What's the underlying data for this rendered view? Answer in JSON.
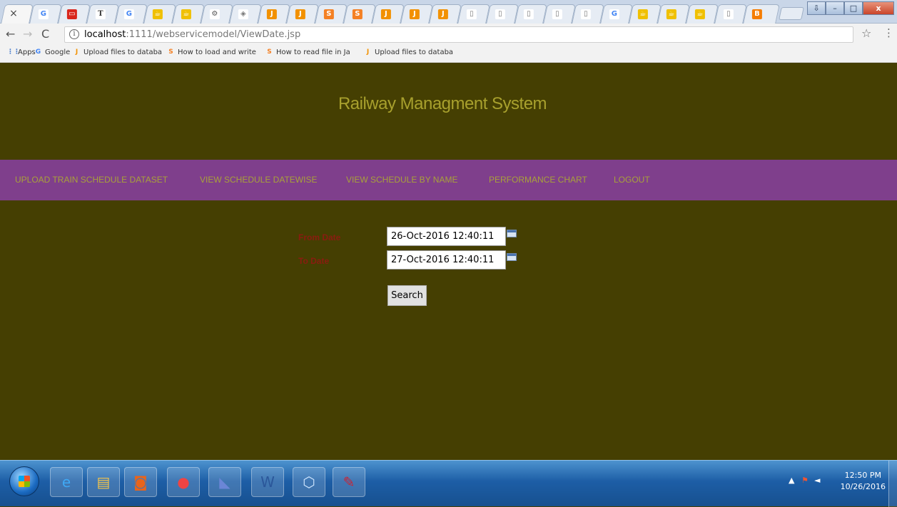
{
  "browser": {
    "url_host": "localhost",
    "url_rest": ":1111/webservicemodel/ViewDate.jsp",
    "bookmarks": [
      {
        "label": "Apps",
        "icon": "apps-grid-icon"
      },
      {
        "label": "Google",
        "icon": "google-icon"
      },
      {
        "label": "Upload files to databa",
        "icon": "javatpoint-icon"
      },
      {
        "label": "How to load and write",
        "icon": "stackoverflow-icon"
      },
      {
        "label": "How to read file in Ja",
        "icon": "stackoverflow-icon"
      },
      {
        "label": "Upload files to databa",
        "icon": "javatpoint-icon"
      }
    ]
  },
  "site": {
    "title": "Railway Managment System"
  },
  "nav": {
    "upload": "UPLOAD TRAIN SCHEDULE DATASET",
    "datewise": "VIEW SCHEDULE DATEWISE",
    "byname": "VIEW SCHEDULE BY NAME",
    "chart": "PERFORMANCE CHART",
    "logout": "LOGOUT"
  },
  "form": {
    "from_label": "From Date",
    "from_value": "26-Oct-2016 12:40:11",
    "to_label": "To Date",
    "to_value": "27-Oct-2016 12:40:11",
    "search_label": "Search"
  },
  "taskbar": {
    "time": "12:50 PM",
    "date": "10/26/2016"
  },
  "colors": {
    "page_bg": "#453f02",
    "title": "#a8a02d",
    "navbar": "#7f3f8c",
    "label": "#8a1c10"
  }
}
